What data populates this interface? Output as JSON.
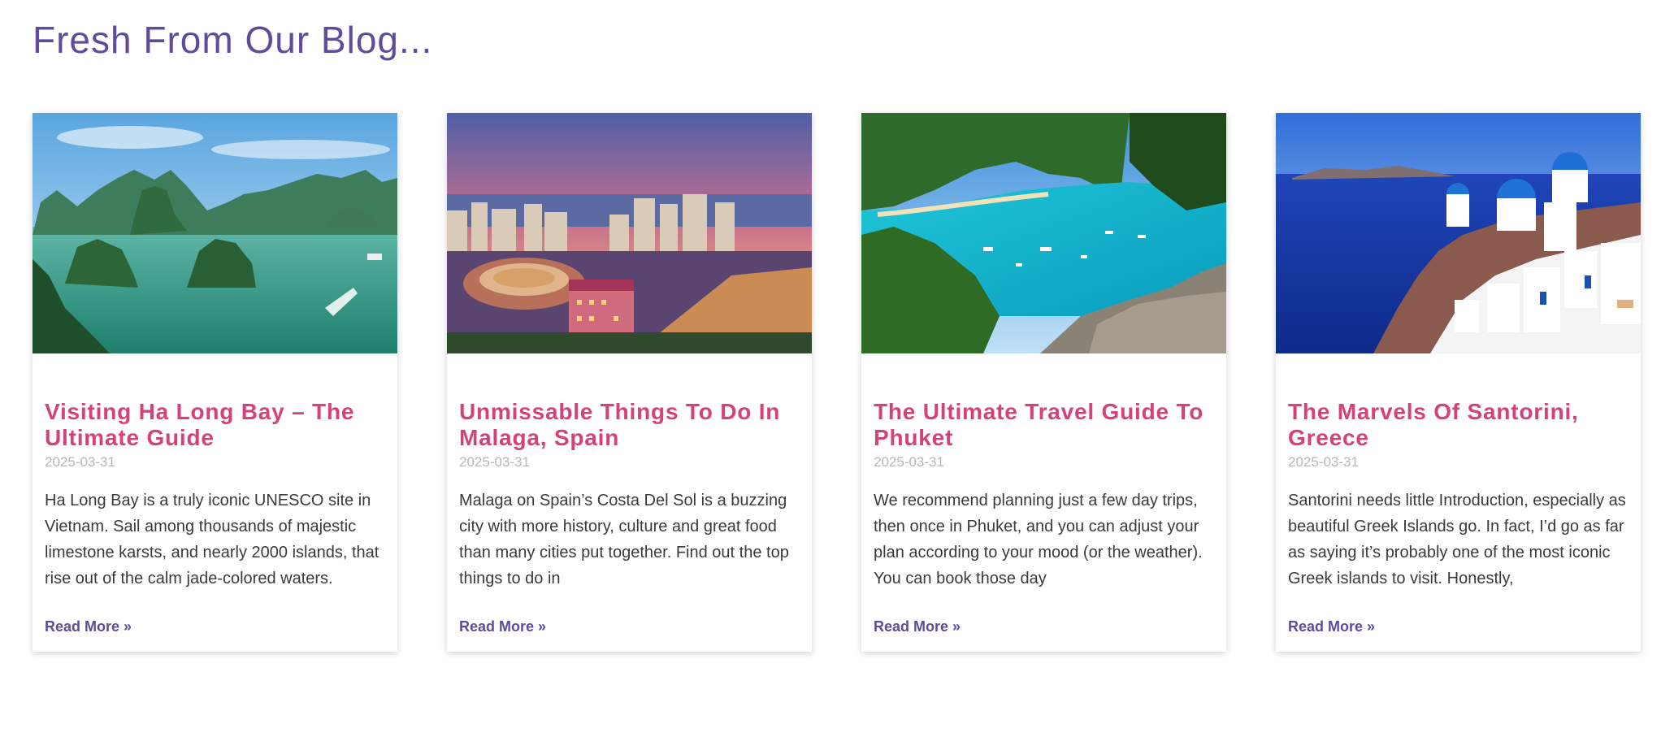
{
  "section": {
    "title": "Fresh From Our Blog..."
  },
  "colors": {
    "title": "#5f4b9c",
    "post_title": "#d5427a",
    "date": "#b7b7b7",
    "link": "#5f4b9c",
    "text": "#3a3a3a"
  },
  "posts": [
    {
      "image": "ha-long-bay-photo",
      "title": "Visiting Ha Long Bay – The Ultimate Guide",
      "date": "2025-03-31",
      "excerpt": "Ha Long Bay is a truly iconic UNESCO site in Vietnam. Sail among thousands of majestic limestone karsts, and nearly 2000 islands, that rise out of the calm jade-colored waters.",
      "read_more": "Read More »"
    },
    {
      "image": "malaga-city-photo",
      "title": "Unmissable Things To Do In Malaga, Spain",
      "date": "2025-03-31",
      "excerpt": "Malaga on Spain’s Costa Del Sol is a buzzing city with more history, culture and great food than many cities put together. Find out the top things to do in",
      "read_more": "Read More »"
    },
    {
      "image": "phuket-beach-photo",
      "title": "The Ultimate Travel Guide To Phuket",
      "date": "2025-03-31",
      "excerpt": "We recommend planning just a few day trips, then once in Phuket, and you can adjust your plan according to your mood (or the weather). You can book those day",
      "read_more": "Read More »"
    },
    {
      "image": "santorini-photo",
      "title": "The Marvels Of Santorini, Greece",
      "date": "2025-03-31",
      "excerpt": "Santorini needs little Introduction, especially as beautiful Greek Islands go. In fact, I’d go as far as saying it’s probably one of the most iconic Greek islands to visit. Honestly,",
      "read_more": "Read More »"
    }
  ]
}
